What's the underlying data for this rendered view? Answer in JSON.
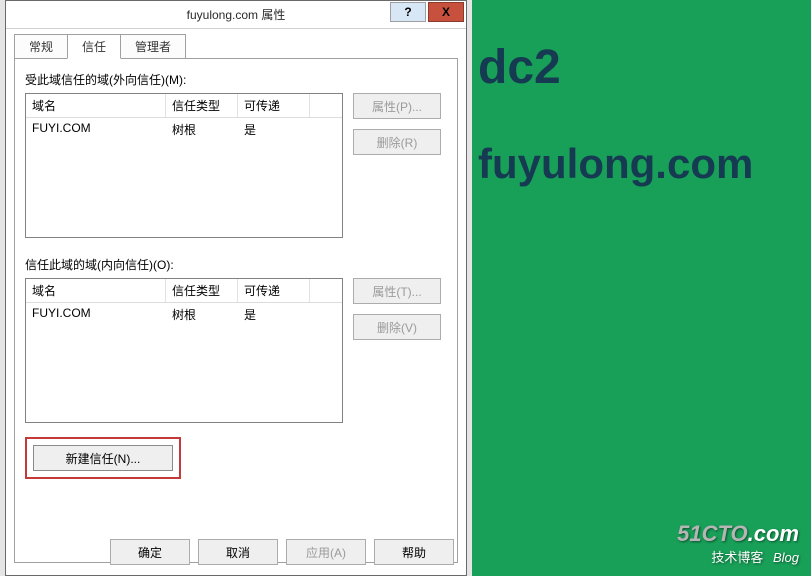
{
  "desktop": {
    "line1": "dc2",
    "line2": "fuyulong.com"
  },
  "watermark": {
    "main_left": "51CTO",
    "main_right": ".com",
    "sub": "技术博客",
    "blog": "Blog"
  },
  "dialog": {
    "title": "fuyulong.com 属性",
    "help": "?",
    "close": "X",
    "tabs": {
      "general": "常规",
      "trust": "信任",
      "managed": "管理者"
    },
    "outgoing": {
      "label": "受此域信任的域(外向信任)(M):",
      "headers": {
        "name": "域名",
        "type": "信任类型",
        "trans": "可传递"
      },
      "rows": [
        {
          "name": "FUYI.COM",
          "type": "树根",
          "trans": "是"
        }
      ],
      "props_btn": "属性(P)...",
      "remove_btn": "删除(R)"
    },
    "incoming": {
      "label": "信任此域的域(内向信任)(O):",
      "headers": {
        "name": "域名",
        "type": "信任类型",
        "trans": "可传递"
      },
      "rows": [
        {
          "name": "FUYI.COM",
          "type": "树根",
          "trans": "是"
        }
      ],
      "props_btn": "属性(T)...",
      "remove_btn": "删除(V)"
    },
    "new_trust": "新建信任(N)...",
    "buttons": {
      "ok": "确定",
      "cancel": "取消",
      "apply": "应用(A)",
      "help": "帮助"
    }
  }
}
